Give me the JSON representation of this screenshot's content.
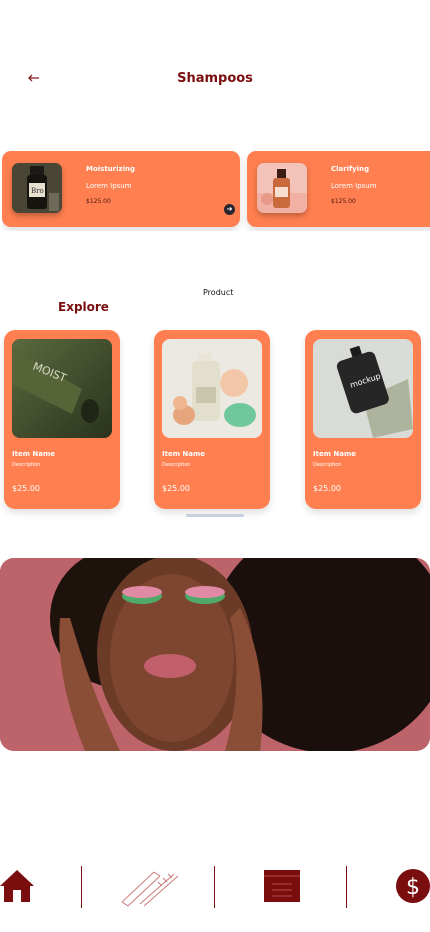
{
  "header": {
    "title": "Shampoos",
    "back_icon": "arrow-left-icon"
  },
  "featured": [
    {
      "name": "Moisturizing",
      "subtitle": "Lorem Ipsum",
      "price": "$125.00",
      "arrow_icon": "arrow-right-icon"
    },
    {
      "name": "Clarifying",
      "subtitle": "Lorem Ipsum",
      "price": "$125.00"
    }
  ],
  "section": {
    "product_label": "Product",
    "explore_title": "Explore"
  },
  "items": [
    {
      "name": "Item Name",
      "description": "Description",
      "price": "$25.00"
    },
    {
      "name": "Item Name",
      "description": "Description",
      "price": "$25.00"
    },
    {
      "name": "Item Name",
      "description": "Description",
      "price": "$25.00"
    }
  ],
  "nav": {
    "items": [
      "home-icon",
      "pencil-icon",
      "calendar-icon",
      "dollar-icon"
    ],
    "dollar_symbol": "$"
  },
  "colors": {
    "accent": "#ff7f50",
    "brand": "#7a0e0e",
    "hero_bg": "#b75c62"
  }
}
